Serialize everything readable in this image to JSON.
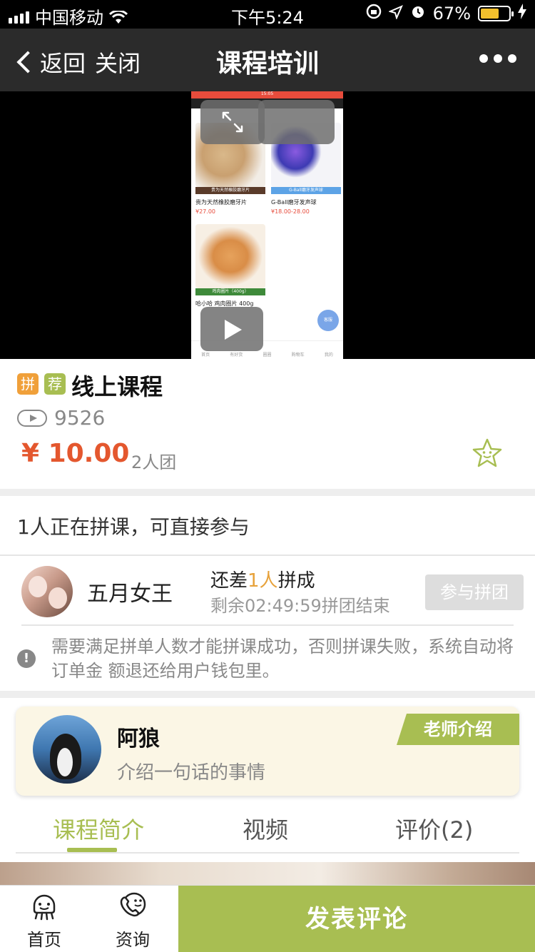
{
  "status_bar": {
    "carrier": "中国移动",
    "time": "下午5:24",
    "battery_percent": "67%",
    "battery_level": 0.67,
    "battery_color": "#f2c02d"
  },
  "nav": {
    "back_label": "返回",
    "close_label": "关闭",
    "title": "课程培训"
  },
  "video_preview": {
    "status_time": "15:05",
    "items": [
      {
        "caption": "贵为天然橡胶磨牙片",
        "price": "¥27.00",
        "bar": "贵为天然橡胶磨牙片"
      },
      {
        "caption": "G-Ball磨牙发声球",
        "price": "¥18.00-28.00",
        "bar": "G-Ball磨牙发声球"
      },
      {
        "caption": "哈小哈 鸡肉圈片 400g",
        "bar": "鸡肉圈片（400g）"
      }
    ],
    "tabs": [
      "首页",
      "有好货",
      "圈圈",
      "购物车",
      "我的"
    ],
    "float_label": "客服"
  },
  "course": {
    "tag_group": "拼",
    "tag_recommend": "荐",
    "title": "线上课程",
    "views": "9526",
    "price": "¥ 10.00",
    "team_size": "2人团"
  },
  "group_buy": {
    "header": "1人正在拼课，可直接参与",
    "user": "五月女王",
    "need_prefix": "还差",
    "need_count": "1人",
    "need_suffix": "拼成",
    "remaining": "剩余02:49:59拼团结束",
    "join_button": "参与拼团",
    "notice": "需要满足拼单人数才能拼课成功，否则拼课失败，系统自动将订单金 额退还给用户钱包里。"
  },
  "teacher": {
    "name": "阿狼",
    "intro": "介绍一句话的事情",
    "badge": "老师介绍"
  },
  "tabs": [
    {
      "label": "课程简介",
      "active": true
    },
    {
      "label": "视频",
      "active": false
    },
    {
      "label": "评价(2)",
      "active": false
    }
  ],
  "bottom_bar": {
    "home_label": "首页",
    "news_label": "资询",
    "comment_button": "发表评论"
  },
  "colors": {
    "accent_green": "#a8be52",
    "price_red": "#e4572e",
    "tag_orange": "#f0a03a",
    "tag_green": "#a8be52",
    "highlight_orange": "#e7a23b"
  }
}
